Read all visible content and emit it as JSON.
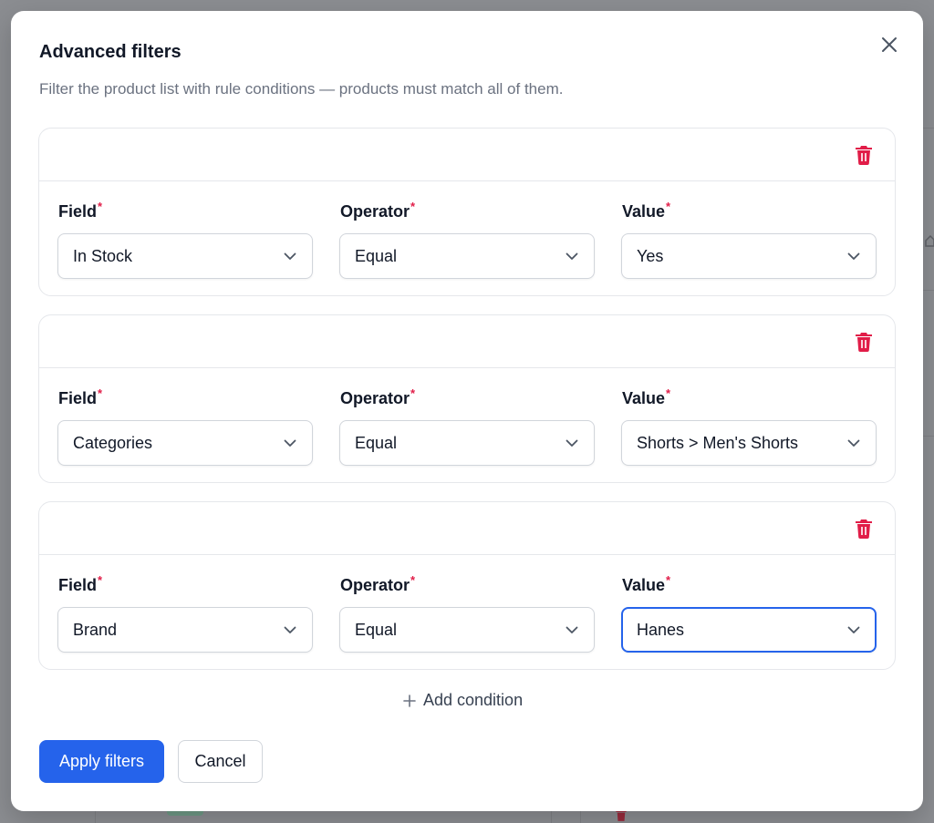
{
  "modal": {
    "title": "Advanced filters",
    "subtitle": "Filter the product list with rule conditions — products must match all of them.",
    "close_icon": "close-icon"
  },
  "labels": {
    "field": "Field",
    "operator": "Operator",
    "value": "Value",
    "required_marker": "*"
  },
  "conditions": [
    {
      "field": "In Stock",
      "operator": "Equal",
      "value": "Yes"
    },
    {
      "field": "Categories",
      "operator": "Equal",
      "value": "Shorts > Men's Shorts"
    },
    {
      "field": "Brand",
      "operator": "Equal",
      "value": "Hanes"
    }
  ],
  "focused_select": "conditions.2.value",
  "actions": {
    "add_condition": "Add condition",
    "apply": "Apply filters",
    "cancel": "Cancel"
  },
  "colors": {
    "primary": "#2563eb",
    "danger": "#e11d48",
    "text": "#111827",
    "muted": "#6b7280"
  }
}
